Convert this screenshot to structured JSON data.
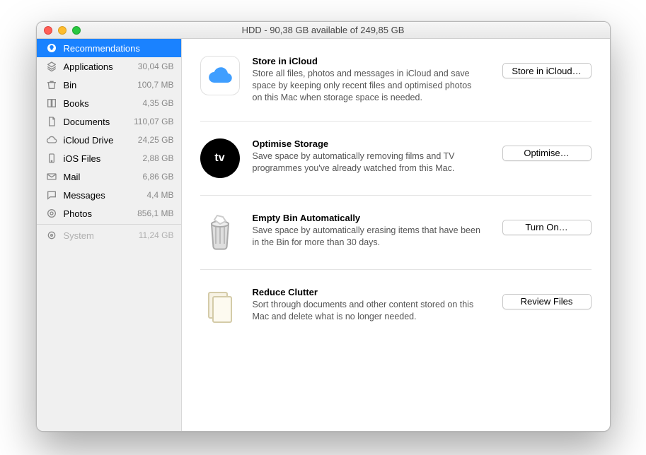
{
  "title": "HDD - 90,38 GB available of 249,85 GB",
  "sidebar": [
    {
      "label": "Recommendations",
      "size": "",
      "icon": "lightbulb",
      "selected": true
    },
    {
      "label": "Applications",
      "size": "30,04 GB",
      "icon": "apps"
    },
    {
      "label": "Bin",
      "size": "100,7 MB",
      "icon": "trash"
    },
    {
      "label": "Books",
      "size": "4,35 GB",
      "icon": "book"
    },
    {
      "label": "Documents",
      "size": "110,07 GB",
      "icon": "doc"
    },
    {
      "label": "iCloud Drive",
      "size": "24,25 GB",
      "icon": "cloud"
    },
    {
      "label": "iOS Files",
      "size": "2,88 GB",
      "icon": "phone"
    },
    {
      "label": "Mail",
      "size": "6,86 GB",
      "icon": "mail"
    },
    {
      "label": "Messages",
      "size": "4,4 MB",
      "icon": "chat"
    },
    {
      "label": "Photos",
      "size": "856,1 MB",
      "icon": "photo"
    },
    {
      "divider": true
    },
    {
      "label": "System",
      "size": "11,24 GB",
      "icon": "gear",
      "dim": true
    }
  ],
  "recommendations": [
    {
      "icon": "icloud",
      "title": "Store in iCloud",
      "desc": "Store all files, photos and messages in iCloud and save space by keeping only recent files and optimised photos on this Mac when storage space is needed.",
      "button": "Store in iCloud…"
    },
    {
      "icon": "tv",
      "title": "Optimise Storage",
      "desc": "Save space by automatically removing films and TV programmes you've already watched from this Mac.",
      "button": "Optimise…"
    },
    {
      "icon": "bin",
      "title": "Empty Bin Automatically",
      "desc": "Save space by automatically erasing items that have been in the Bin for more than 30 days.",
      "button": "Turn On…"
    },
    {
      "icon": "docs",
      "title": "Reduce Clutter",
      "desc": "Sort through documents and other content stored on this Mac and delete what is no longer needed.",
      "button": "Review Files"
    }
  ]
}
